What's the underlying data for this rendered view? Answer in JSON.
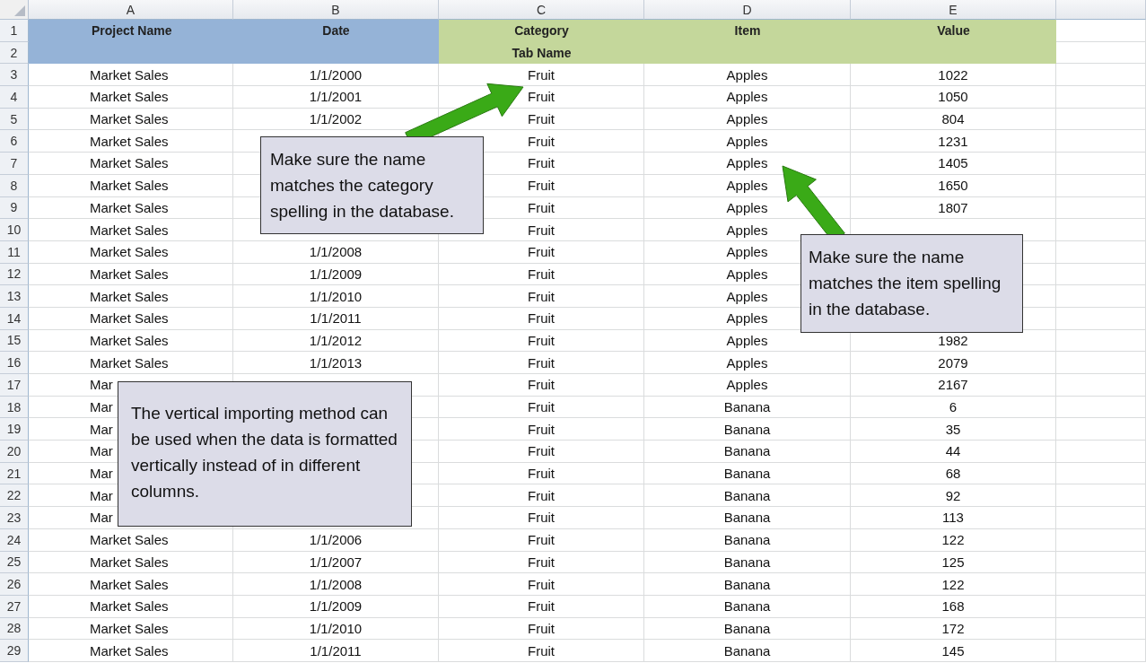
{
  "columns": [
    {
      "letter": "A",
      "color": "#95b3d7"
    },
    {
      "letter": "B",
      "color": "#95b3d7"
    },
    {
      "letter": "C",
      "color": "#c4d79b"
    },
    {
      "letter": "D",
      "color": "#c4d79b"
    },
    {
      "letter": "E",
      "color": "#c4d79b"
    }
  ],
  "header_rows": [
    {
      "num": "1",
      "cells": {
        "A": "Project Name",
        "B": "Date",
        "C": "Category",
        "D": "Item",
        "E": "Value"
      }
    },
    {
      "num": "2",
      "cells": {
        "C": "Tab Name"
      }
    }
  ],
  "rows": [
    {
      "num": "3",
      "cells": {
        "A": "Market Sales",
        "B": "1/1/2000",
        "C": "Fruit",
        "D": "Apples",
        "E": "1022"
      }
    },
    {
      "num": "4",
      "cells": {
        "A": "Market Sales",
        "B": "1/1/2001",
        "C": "Fruit",
        "D": "Apples",
        "E": "1050"
      }
    },
    {
      "num": "5",
      "cells": {
        "A": "Market Sales",
        "B": "1/1/2002",
        "C": "Fruit",
        "D": "Apples",
        "E": "804"
      }
    },
    {
      "num": "6",
      "cells": {
        "A": "Market Sales",
        "C": "Fruit",
        "D": "Apples",
        "E": "1231"
      }
    },
    {
      "num": "7",
      "cells": {
        "A": "Market Sales",
        "C": "Fruit",
        "D": "Apples",
        "E": "1405"
      }
    },
    {
      "num": "8",
      "cells": {
        "A": "Market Sales",
        "C": "Fruit",
        "D": "Apples",
        "E": "1650"
      }
    },
    {
      "num": "9",
      "cells": {
        "A": "Market Sales",
        "C": "Fruit",
        "D": "Apples",
        "E": "1807"
      }
    },
    {
      "num": "10",
      "cells": {
        "A": "Market Sales",
        "C": "Fruit",
        "D": "Apples"
      }
    },
    {
      "num": "11",
      "cells": {
        "A": "Market Sales",
        "B": "1/1/2008",
        "C": "Fruit",
        "D": "Apples"
      }
    },
    {
      "num": "12",
      "cells": {
        "A": "Market Sales",
        "B": "1/1/2009",
        "C": "Fruit",
        "D": "Apples"
      }
    },
    {
      "num": "13",
      "cells": {
        "A": "Market Sales",
        "B": "1/1/2010",
        "C": "Fruit",
        "D": "Apples"
      }
    },
    {
      "num": "14",
      "cells": {
        "A": "Market Sales",
        "B": "1/1/2011",
        "C": "Fruit",
        "D": "Apples"
      }
    },
    {
      "num": "15",
      "cells": {
        "A": "Market Sales",
        "B": "1/1/2012",
        "C": "Fruit",
        "D": "Apples",
        "E": "1982"
      }
    },
    {
      "num": "16",
      "cells": {
        "A": "Market Sales",
        "B": "1/1/2013",
        "C": "Fruit",
        "D": "Apples",
        "E": "2079"
      }
    },
    {
      "num": "17",
      "cells": {
        "A": "Mar",
        "C": "Fruit",
        "D": "Apples",
        "E": "2167"
      }
    },
    {
      "num": "18",
      "cells": {
        "A": "Mar",
        "C": "Fruit",
        "D": "Banana",
        "E": "6"
      }
    },
    {
      "num": "19",
      "cells": {
        "A": "Mar",
        "C": "Fruit",
        "D": "Banana",
        "E": "35"
      }
    },
    {
      "num": "20",
      "cells": {
        "A": "Mar",
        "C": "Fruit",
        "D": "Banana",
        "E": "44"
      }
    },
    {
      "num": "21",
      "cells": {
        "A": "Mar",
        "C": "Fruit",
        "D": "Banana",
        "E": "68"
      }
    },
    {
      "num": "22",
      "cells": {
        "A": "Mar",
        "C": "Fruit",
        "D": "Banana",
        "E": "92"
      }
    },
    {
      "num": "23",
      "cells": {
        "A": "Mar",
        "C": "Fruit",
        "D": "Banana",
        "E": "113"
      }
    },
    {
      "num": "24",
      "cells": {
        "A": "Market Sales",
        "B": "1/1/2006",
        "C": "Fruit",
        "D": "Banana",
        "E": "122"
      }
    },
    {
      "num": "25",
      "cells": {
        "A": "Market Sales",
        "B": "1/1/2007",
        "C": "Fruit",
        "D": "Banana",
        "E": "125"
      }
    },
    {
      "num": "26",
      "cells": {
        "A": "Market Sales",
        "B": "1/1/2008",
        "C": "Fruit",
        "D": "Banana",
        "E": "122"
      }
    },
    {
      "num": "27",
      "cells": {
        "A": "Market Sales",
        "B": "1/1/2009",
        "C": "Fruit",
        "D": "Banana",
        "E": "168"
      }
    },
    {
      "num": "28",
      "cells": {
        "A": "Market Sales",
        "B": "1/1/2010",
        "C": "Fruit",
        "D": "Banana",
        "E": "172"
      }
    },
    {
      "num": "29",
      "cells": {
        "A": "Market Sales",
        "B": "1/1/2011",
        "C": "Fruit",
        "D": "Banana",
        "E": "145"
      }
    }
  ],
  "callouts": [
    {
      "text": "Make sure the name matches the category spelling in the database."
    },
    {
      "text": "Make sure the name matches the item spelling in the database."
    },
    {
      "text": "The vertical importing method can be used when the data is formatted vertically instead of in different columns."
    }
  ]
}
